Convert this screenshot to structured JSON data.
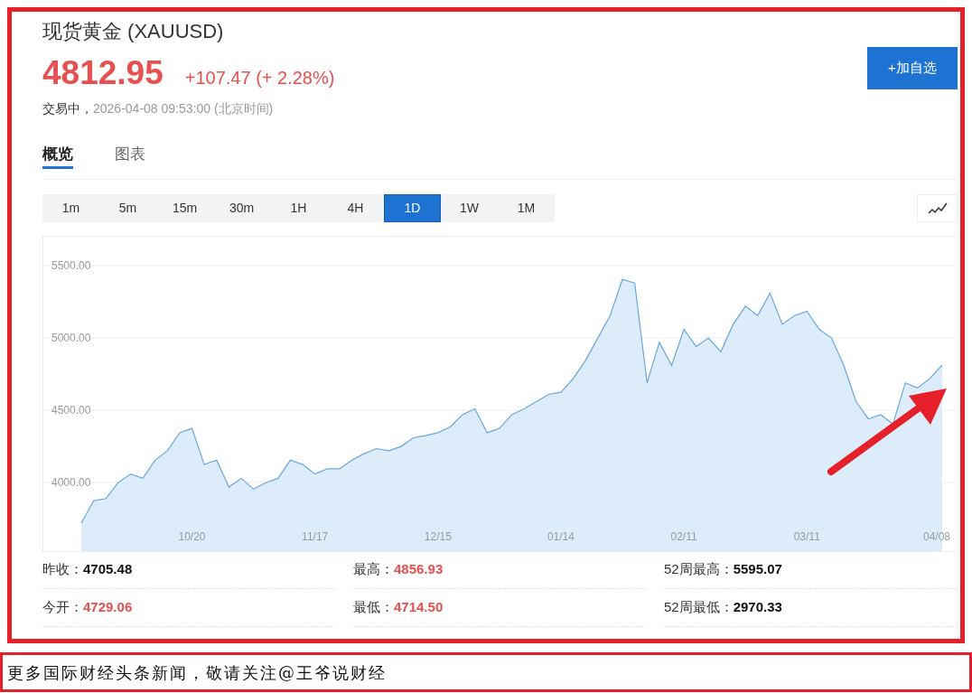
{
  "header": {
    "title": "现货黄金 (XAUUSD)",
    "price": "4812.95",
    "change": "+107.47 (+ 2.28%)",
    "status": "交易中，",
    "timestamp": "2026-04-08 09:53:00 (北京时间)",
    "watchlist_button": "+加自选"
  },
  "tabs": [
    {
      "label": "概览",
      "selected": true
    },
    {
      "label": "图表",
      "selected": false
    }
  ],
  "ranges": [
    {
      "label": "1m",
      "selected": false
    },
    {
      "label": "5m",
      "selected": false
    },
    {
      "label": "15m",
      "selected": false
    },
    {
      "label": "30m",
      "selected": false
    },
    {
      "label": "1H",
      "selected": false
    },
    {
      "label": "4H",
      "selected": false
    },
    {
      "label": "1D",
      "selected": true
    },
    {
      "label": "1W",
      "selected": false
    },
    {
      "label": "1M",
      "selected": false
    }
  ],
  "chart_data": {
    "type": "area",
    "grid": true,
    "ylim": [
      3520,
      5700
    ],
    "categories": [
      null,
      null,
      null,
      null,
      null,
      null,
      null,
      null,
      null,
      "10/20",
      null,
      null,
      null,
      null,
      null,
      null,
      null,
      null,
      null,
      "11/17",
      null,
      null,
      null,
      null,
      null,
      null,
      null,
      null,
      null,
      "12/15",
      null,
      null,
      null,
      null,
      null,
      null,
      null,
      null,
      null,
      "01/14",
      null,
      null,
      null,
      null,
      null,
      null,
      null,
      null,
      null,
      "02/11",
      null,
      null,
      null,
      null,
      null,
      null,
      null,
      null,
      null,
      "03/11",
      null,
      null,
      null,
      null,
      null,
      null,
      null,
      null,
      null,
      null,
      "04/08"
    ],
    "yticks": [
      {
        "value": 4000,
        "label": "4000.00"
      },
      {
        "value": 4500,
        "label": "4500.00"
      },
      {
        "value": 5000,
        "label": "5000.00"
      },
      {
        "value": 5500,
        "label": "5500.00"
      }
    ],
    "series": [
      {
        "color": "#6aa6dc",
        "values": [
          3720,
          3875,
          3890,
          4000,
          4060,
          4030,
          4155,
          4220,
          4345,
          4375,
          4125,
          4155,
          3970,
          4030,
          3955,
          4000,
          4030,
          4155,
          4125,
          4060,
          4095,
          4095,
          4155,
          4200,
          4235,
          4220,
          4250,
          4310,
          4325,
          4345,
          4385,
          4470,
          4510,
          4345,
          4375,
          4470,
          4510,
          4560,
          4610,
          4625,
          4720,
          4845,
          5000,
          5155,
          5405,
          5380,
          4690,
          4970,
          4810,
          5060,
          4940,
          5000,
          4905,
          5095,
          5220,
          5155,
          5310,
          5095,
          5155,
          5185,
          5060,
          5000,
          4810,
          4560,
          4440,
          4470,
          4405,
          4690,
          4655,
          4720,
          4813
        ]
      }
    ]
  },
  "stats": [
    {
      "label": "昨收：",
      "value": "4705.48",
      "color": "#111111"
    },
    {
      "label": "最高：",
      "value": "4856.93",
      "color": "#e84f4f"
    },
    {
      "label": "52周最高：",
      "value": "5595.07",
      "color": "#111111"
    },
    {
      "label": "今开：",
      "value": "4729.06",
      "color": "#e84f4f"
    },
    {
      "label": "最低：",
      "value": "4714.50",
      "color": "#e84f4f"
    },
    {
      "label": "52周最低：",
      "value": "2970.33",
      "color": "#111111"
    }
  ],
  "footer": {
    "text": "更多国际财经头条新闻，敬请关注@王爷说财经"
  }
}
